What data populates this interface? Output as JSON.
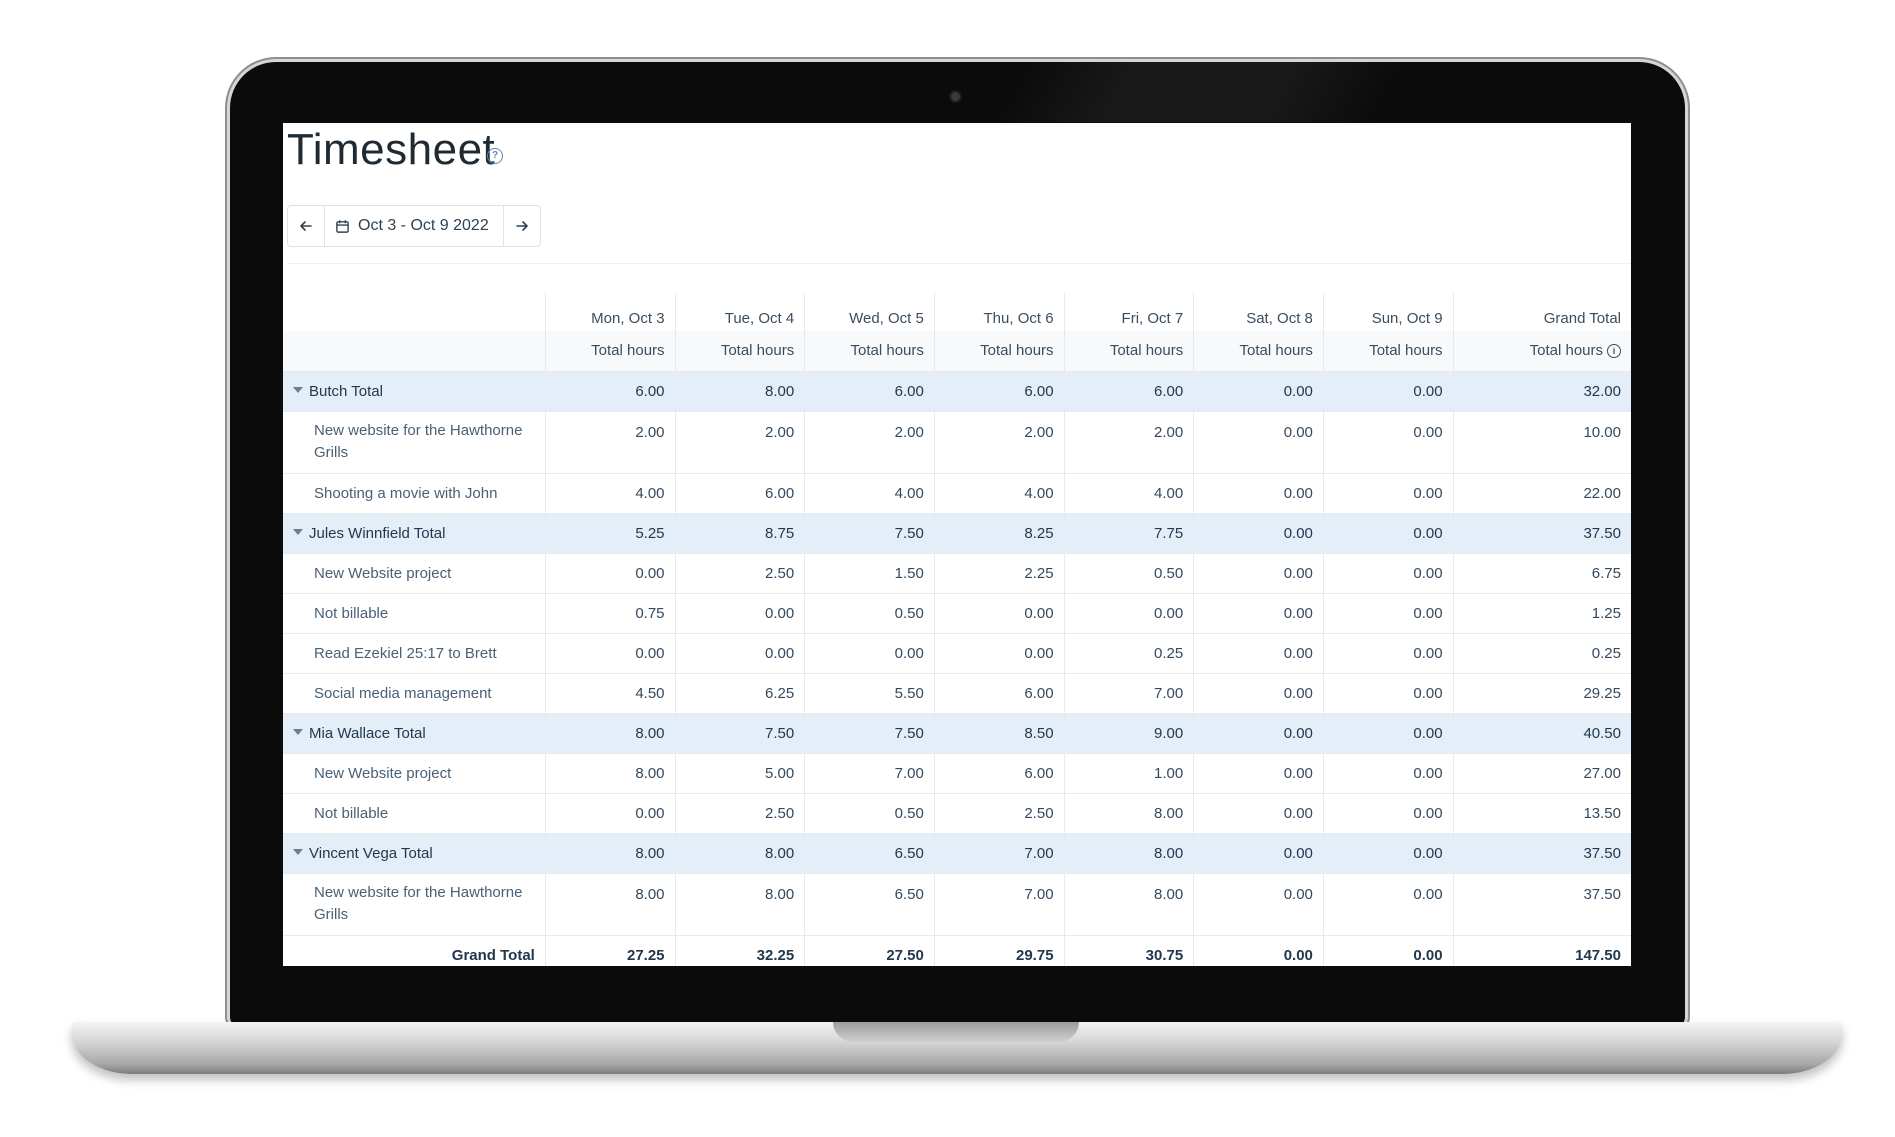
{
  "page": {
    "title": "Timesheet",
    "help_icon": "question-circle-icon"
  },
  "date_nav": {
    "prev_icon": "arrow-left-icon",
    "calendar_icon": "calendar-icon",
    "range": "Oct 3 - Oct 9 2022",
    "next_icon": "arrow-right-icon"
  },
  "table": {
    "columns": [
      "Mon, Oct 3",
      "Tue, Oct 4",
      "Wed, Oct 5",
      "Thu, Oct 6",
      "Fri, Oct 7",
      "Sat, Oct 8",
      "Sun, Oct 9",
      "Grand Total"
    ],
    "subheader": "Total hours",
    "groups": [
      {
        "label": "Butch Total",
        "values": [
          "6.00",
          "8.00",
          "6.00",
          "6.00",
          "6.00",
          "0.00",
          "0.00",
          "32.00"
        ],
        "items": [
          {
            "label": "New website for the Hawthorne Grills",
            "values": [
              "2.00",
              "2.00",
              "2.00",
              "2.00",
              "2.00",
              "0.00",
              "0.00",
              "10.00"
            ]
          },
          {
            "label": "Shooting a movie with John",
            "values": [
              "4.00",
              "6.00",
              "4.00",
              "4.00",
              "4.00",
              "0.00",
              "0.00",
              "22.00"
            ]
          }
        ]
      },
      {
        "label": "Jules Winnfield Total",
        "values": [
          "5.25",
          "8.75",
          "7.50",
          "8.25",
          "7.75",
          "0.00",
          "0.00",
          "37.50"
        ],
        "items": [
          {
            "label": "New Website project",
            "values": [
              "0.00",
              "2.50",
              "1.50",
              "2.25",
              "0.50",
              "0.00",
              "0.00",
              "6.75"
            ]
          },
          {
            "label": "Not billable",
            "values": [
              "0.75",
              "0.00",
              "0.50",
              "0.00",
              "0.00",
              "0.00",
              "0.00",
              "1.25"
            ]
          },
          {
            "label": "Read Ezekiel 25:17 to Brett",
            "values": [
              "0.00",
              "0.00",
              "0.00",
              "0.00",
              "0.25",
              "0.00",
              "0.00",
              "0.25"
            ]
          },
          {
            "label": "Social media management",
            "values": [
              "4.50",
              "6.25",
              "5.50",
              "6.00",
              "7.00",
              "0.00",
              "0.00",
              "29.25"
            ]
          }
        ]
      },
      {
        "label": "Mia Wallace Total",
        "values": [
          "8.00",
          "7.50",
          "7.50",
          "8.50",
          "9.00",
          "0.00",
          "0.00",
          "40.50"
        ],
        "items": [
          {
            "label": "New Website project",
            "values": [
              "8.00",
              "5.00",
              "7.00",
              "6.00",
              "1.00",
              "0.00",
              "0.00",
              "27.00"
            ]
          },
          {
            "label": "Not billable",
            "values": [
              "0.00",
              "2.50",
              "0.50",
              "2.50",
              "8.00",
              "0.00",
              "0.00",
              "13.50"
            ]
          }
        ]
      },
      {
        "label": "Vincent Vega Total",
        "values": [
          "8.00",
          "8.00",
          "6.50",
          "7.00",
          "8.00",
          "0.00",
          "0.00",
          "37.50"
        ],
        "items": [
          {
            "label": "New website for the Hawthorne Grills",
            "values": [
              "8.00",
              "8.00",
              "6.50",
              "7.00",
              "8.00",
              "0.00",
              "0.00",
              "37.50"
            ]
          }
        ]
      }
    ],
    "grand_total": {
      "label": "Grand Total",
      "values": [
        "27.25",
        "32.25",
        "27.50",
        "29.75",
        "30.75",
        "0.00",
        "0.00",
        "147.50"
      ]
    }
  },
  "colors": {
    "group_row_bg": "#e3eef9",
    "text": "#34495e",
    "accent": "#5a8ab8"
  }
}
